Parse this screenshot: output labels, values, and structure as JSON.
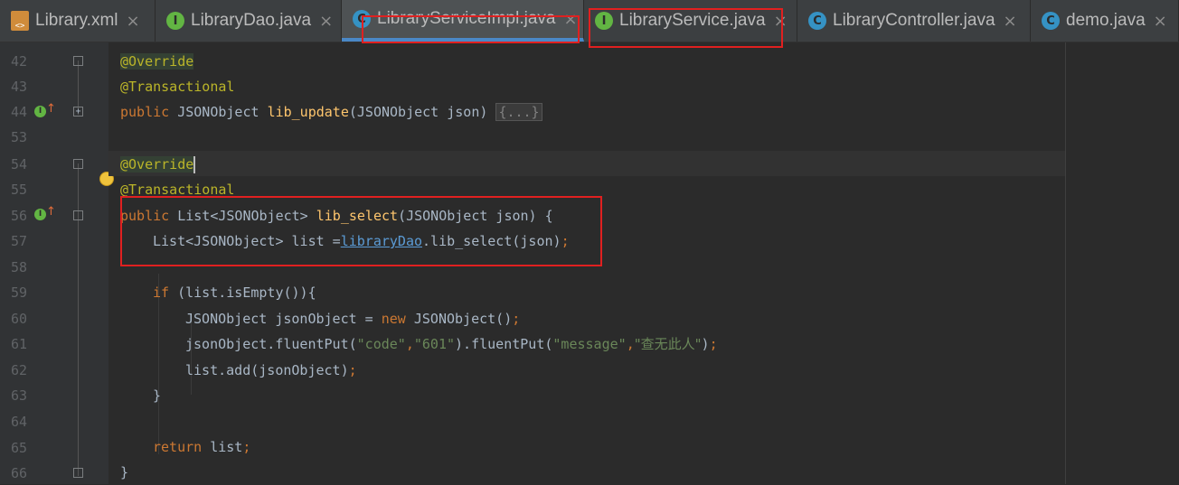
{
  "tabs": [
    {
      "label": "Library.xml",
      "icon": "xml-file-icon",
      "close": "×"
    },
    {
      "label": "LibraryDao.java",
      "icon": "interface-icon",
      "icon_letter": "I",
      "close": "×"
    },
    {
      "label": "LibraryServiceImpl.java",
      "icon": "class-icon",
      "icon_letter": "C",
      "close": "×",
      "active": true
    },
    {
      "label": "LibraryService.java",
      "icon": "interface-icon",
      "icon_letter": "I",
      "close": "×"
    },
    {
      "label": "LibraryController.java",
      "icon": "class-icon",
      "icon_letter": "C",
      "close": "×"
    },
    {
      "label": "demo.java",
      "icon": "class-icon",
      "icon_letter": "C",
      "close": "×"
    }
  ],
  "line_numbers": [
    "42",
    "43",
    "44",
    "53",
    "54",
    "55",
    "56",
    "57",
    "58",
    "59",
    "60",
    "61",
    "62",
    "63",
    "64",
    "65",
    "66"
  ],
  "code": {
    "l42": "@Override",
    "l43": "@Transactional",
    "l44_kw": "public",
    "l44_type": " JSONObject ",
    "l44_fn": "lib_update",
    "l44_args": "(JSONObject json) ",
    "l44_collapsed": "{...}",
    "l54": "@Override",
    "l55": "@Transactional",
    "l56_kw": "public",
    "l56_type": " List<JSONObject> ",
    "l56_fn": "lib_select",
    "l56_args": "(JSONObject json) {",
    "l57_a": "List<JSONObject> list =",
    "l57_field": "libraryDao",
    "l57_b": ".lib_select(json)",
    "l57_semi": ";",
    "l59_kw": "if",
    "l59_rest": " (list.isEmpty()){",
    "l60_a": "JSONObject jsonObject = ",
    "l60_kw": "new",
    "l60_b": " JSONObject()",
    "l60_semi": ";",
    "l61_a": "jsonObject.fluentPut(",
    "l61_s1": "\"code\"",
    "l61_c1": ",",
    "l61_s2": "\"601\"",
    "l61_b": ").fluentPut(",
    "l61_s3": "\"message\"",
    "l61_c2": ",",
    "l61_s4": "\"查无此人\"",
    "l61_end": ")",
    "l61_semi": ";",
    "l62_a": "list.add(jsonObject)",
    "l62_semi": ";",
    "l63": "}",
    "l65_kw": "return",
    "l65_rest": " list",
    "l65_semi": ";",
    "l66": "}"
  },
  "colors": {
    "background": "#2b2b2b",
    "keyword": "#cc7832",
    "annotation": "#bbb529",
    "method": "#ffc66d",
    "string": "#6a8759",
    "highlight_box": "#e02020"
  }
}
